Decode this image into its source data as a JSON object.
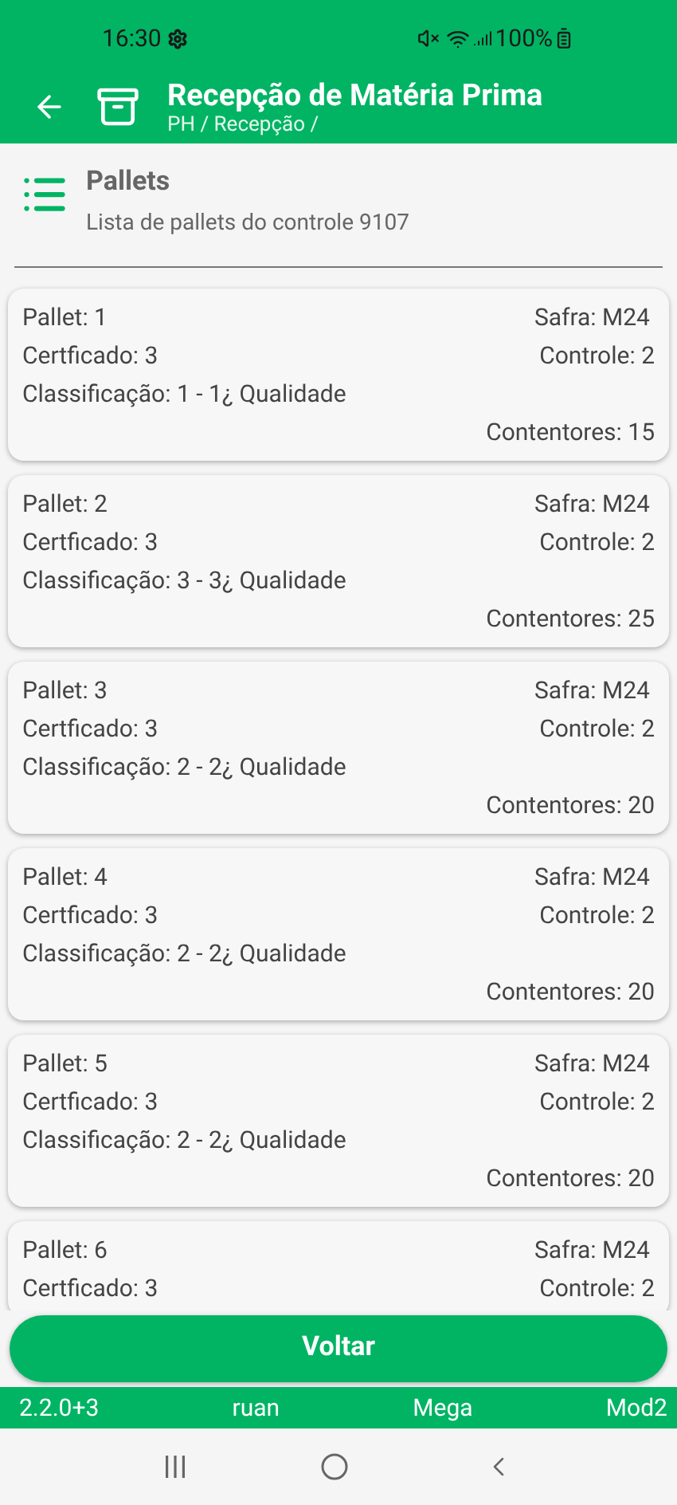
{
  "status_bar": {
    "time": "16:30",
    "battery": "100%"
  },
  "app_bar": {
    "title": "Recepção de Matéria Prima",
    "breadcrumb": "PH / Recepção /"
  },
  "section": {
    "title": "Pallets",
    "subtitle": "Lista de pallets do controle 9107"
  },
  "pallets": [
    {
      "pallet": "Pallet: 1",
      "safra": "Safra: M24",
      "certificado": "Certficado: 3",
      "controle": "Controle: 2",
      "classificacao": "Classificação: 1 - 1¿ Qualidade",
      "contentores": "Contentores: 15"
    },
    {
      "pallet": "Pallet: 2",
      "safra": "Safra: M24",
      "certificado": "Certficado: 3",
      "controle": "Controle: 2",
      "classificacao": "Classificação: 3 - 3¿ Qualidade",
      "contentores": "Contentores: 25"
    },
    {
      "pallet": "Pallet: 3",
      "safra": "Safra: M24",
      "certificado": "Certficado: 3",
      "controle": "Controle: 2",
      "classificacao": "Classificação: 2 - 2¿ Qualidade",
      "contentores": "Contentores: 20"
    },
    {
      "pallet": "Pallet: 4",
      "safra": "Safra: M24",
      "certificado": "Certficado: 3",
      "controle": "Controle: 2",
      "classificacao": "Classificação: 2 - 2¿ Qualidade",
      "contentores": "Contentores: 20"
    },
    {
      "pallet": "Pallet: 5",
      "safra": "Safra: M24",
      "certificado": "Certficado: 3",
      "controle": "Controle: 2",
      "classificacao": "Classificação: 2 - 2¿ Qualidade",
      "contentores": "Contentores: 20"
    },
    {
      "pallet": "Pallet: 6",
      "safra": "Safra: M24",
      "certificado": "Certficado: 3",
      "controle": "Controle: 2"
    }
  ],
  "button": "Voltar",
  "footer": [
    "2.2.0+3",
    "ruan",
    "Mega",
    "Mod2"
  ]
}
